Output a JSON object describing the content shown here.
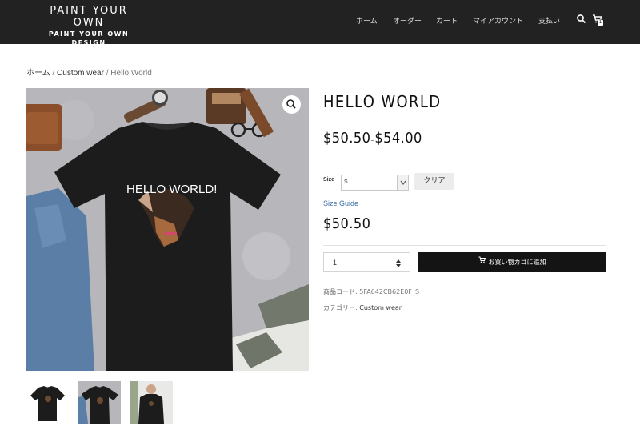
{
  "header": {
    "logo_line1": "PAINT YOUR",
    "logo_line2": "OWN",
    "logo_tagline": "PAINT YOUR OWN DESIGN",
    "nav": [
      "ホーム",
      "オーダー",
      "カート",
      "マイアカウント",
      "支払い"
    ],
    "cart_count": "1",
    "icons": [
      "search-icon",
      "cart-icon"
    ]
  },
  "breadcrumb": {
    "home": "ホーム",
    "category": "Custom wear",
    "current": "Hello World",
    "separator": "/"
  },
  "gallery": {
    "image_text": "HELLO WORLD!",
    "zoom_icon": "magnifier-icon",
    "thumbnails": 3
  },
  "product": {
    "title": "HELLO WORLD",
    "price_min": "$50.50",
    "price_max": "$54.00",
    "price_dash": "–",
    "size_label": "Size",
    "size_value": "S",
    "clear_label": "クリア",
    "size_guide": "Size Guide",
    "selected_price": "$50.50",
    "quantity": "1",
    "add_to_cart": "お買い物カゴに追加",
    "sku_label": "商品コード:",
    "sku_value": "5FA642CB62E0F_S",
    "category_label": "カテゴリー:",
    "category_value": "Custom wear"
  },
  "colors": {
    "header_bg": "#222222",
    "button_bg": "#141414",
    "link": "#3a6ea5"
  }
}
